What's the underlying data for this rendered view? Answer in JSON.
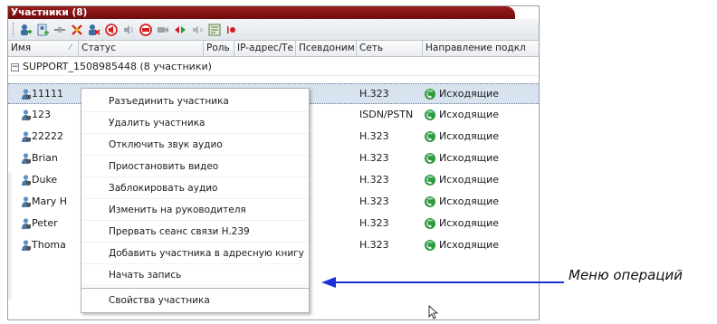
{
  "window": {
    "title": "Участники (8)"
  },
  "toolbar": {
    "icons": [
      "add-participant-icon",
      "add-from-addressbook-icon",
      "connect-icon",
      "disconnect-icon",
      "delete-participant-icon",
      "mute-audio-icon",
      "unmute-audio-icon",
      "block-icon",
      "suspend-video-icon",
      "change-leader-icon",
      "volume-icon",
      "properties-icon",
      "record-icon"
    ]
  },
  "columns": {
    "name": "Имя",
    "status": "Статус",
    "role": "Роль",
    "ip": "IP-адрес/Те",
    "alias": "Псевдоним",
    "network": "Сеть",
    "direction": "Направление подкл"
  },
  "group": {
    "label": "SUPPORT_1508985448 (8  участники)"
  },
  "rows": [
    {
      "name": "11111",
      "network": "H.323",
      "direction": "Исходящие"
    },
    {
      "name": "123",
      "network": "ISDN/PSTN",
      "direction": "Исходящие"
    },
    {
      "name": "22222",
      "network": "H.323",
      "direction": "Исходящие"
    },
    {
      "name": "Brian",
      "network": "H.323",
      "direction": "Исходящие"
    },
    {
      "name": "Duke",
      "network": "H.323",
      "direction": "Исходящие"
    },
    {
      "name": "Mary H",
      "network": "H.323",
      "direction": "Исходящие"
    },
    {
      "name": "Peter",
      "network": "H.323",
      "direction": "Исходящие"
    },
    {
      "name": "Thoma",
      "network": "H.323",
      "direction": "Исходящие"
    }
  ],
  "menu": {
    "items": [
      "Разъединить участника",
      "Удалить участника",
      "Отключить звук аудио",
      "Приостановить видео",
      "Заблокировать аудио",
      "Изменить на руководителя",
      "Прервать сеанс связи H.239",
      "Добавить участника в адресную книгу",
      "Начать запись",
      "Свойства участника"
    ]
  },
  "annotation": {
    "label": "Меню операций"
  },
  "colors": {
    "title_bar": "#8a1414",
    "arrow": "#1a32d6",
    "selected_row": "#d9e3f0"
  }
}
